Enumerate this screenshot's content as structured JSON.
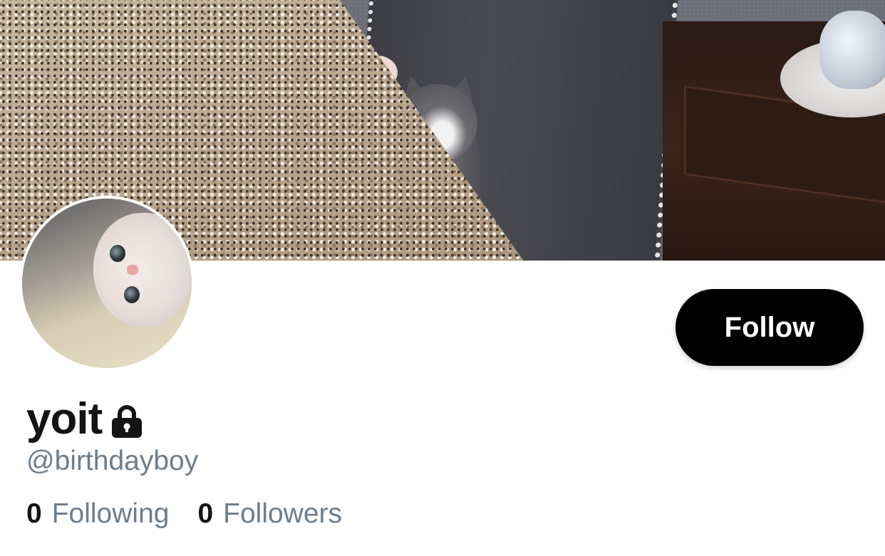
{
  "profile": {
    "display_name": "yoit",
    "handle": "@birthdayboy",
    "protected": true,
    "lock_icon": "lock-icon"
  },
  "actions": {
    "follow_label": "Follow"
  },
  "stats": {
    "following_count": "0",
    "following_label": "Following",
    "followers_count": "0",
    "followers_label": "Followers"
  },
  "colors": {
    "text_primary": "#141414",
    "text_secondary": "#6e7d8b",
    "button_bg": "#000000",
    "button_text": "#ffffff"
  }
}
